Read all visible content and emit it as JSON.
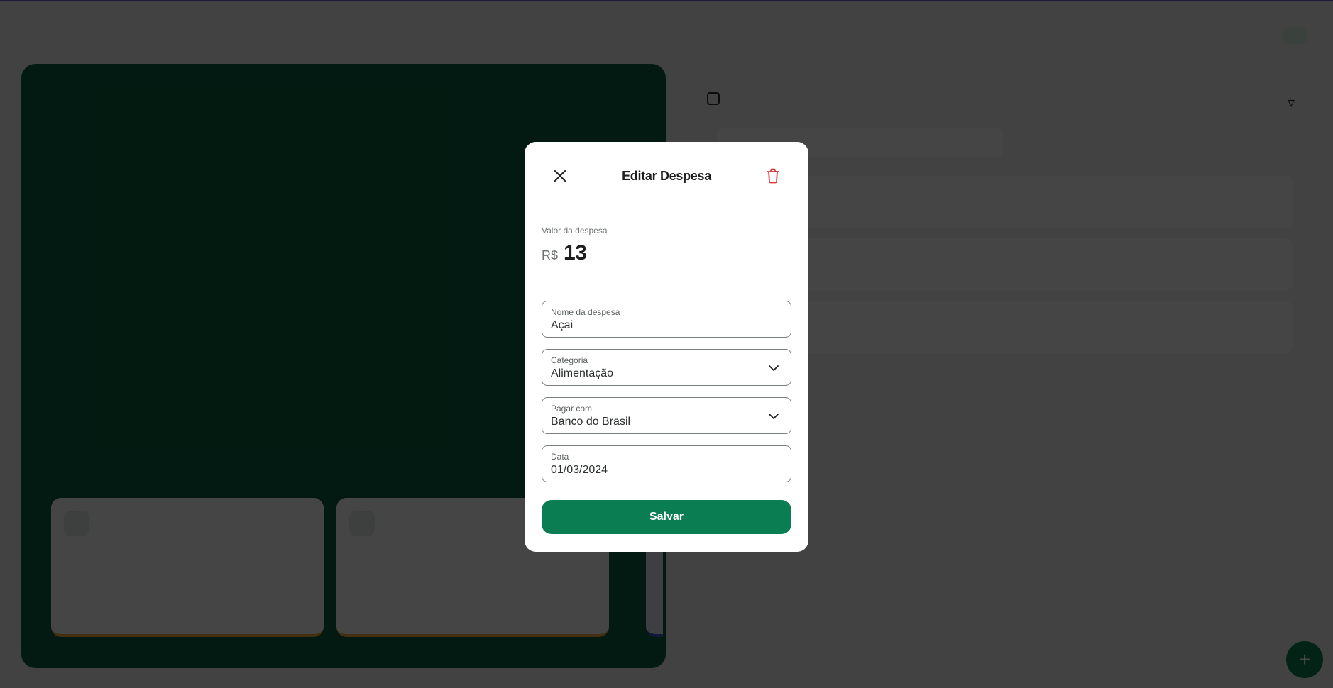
{
  "modal": {
    "title": "Editar Despesa",
    "value_label": "Valor da despesa",
    "currency": "R$",
    "amount": "13",
    "fields": {
      "name": {
        "label": "Nome da despesa",
        "value": "Açai"
      },
      "category": {
        "label": "Categoria",
        "value": "Alimentação"
      },
      "pay_with": {
        "label": "Pagar com",
        "value": "Banco do Brasil"
      },
      "date": {
        "label": "Data",
        "value": "01/03/2024"
      }
    },
    "save_label": "Salvar"
  },
  "icons": {
    "close": "close-icon",
    "delete": "trash-icon",
    "dropdown": "chevron-down-icon"
  },
  "colors": {
    "primary": "#0b7d52",
    "danger": "#d23b3b",
    "overlay": "rgba(0,0,0,0.72)"
  }
}
